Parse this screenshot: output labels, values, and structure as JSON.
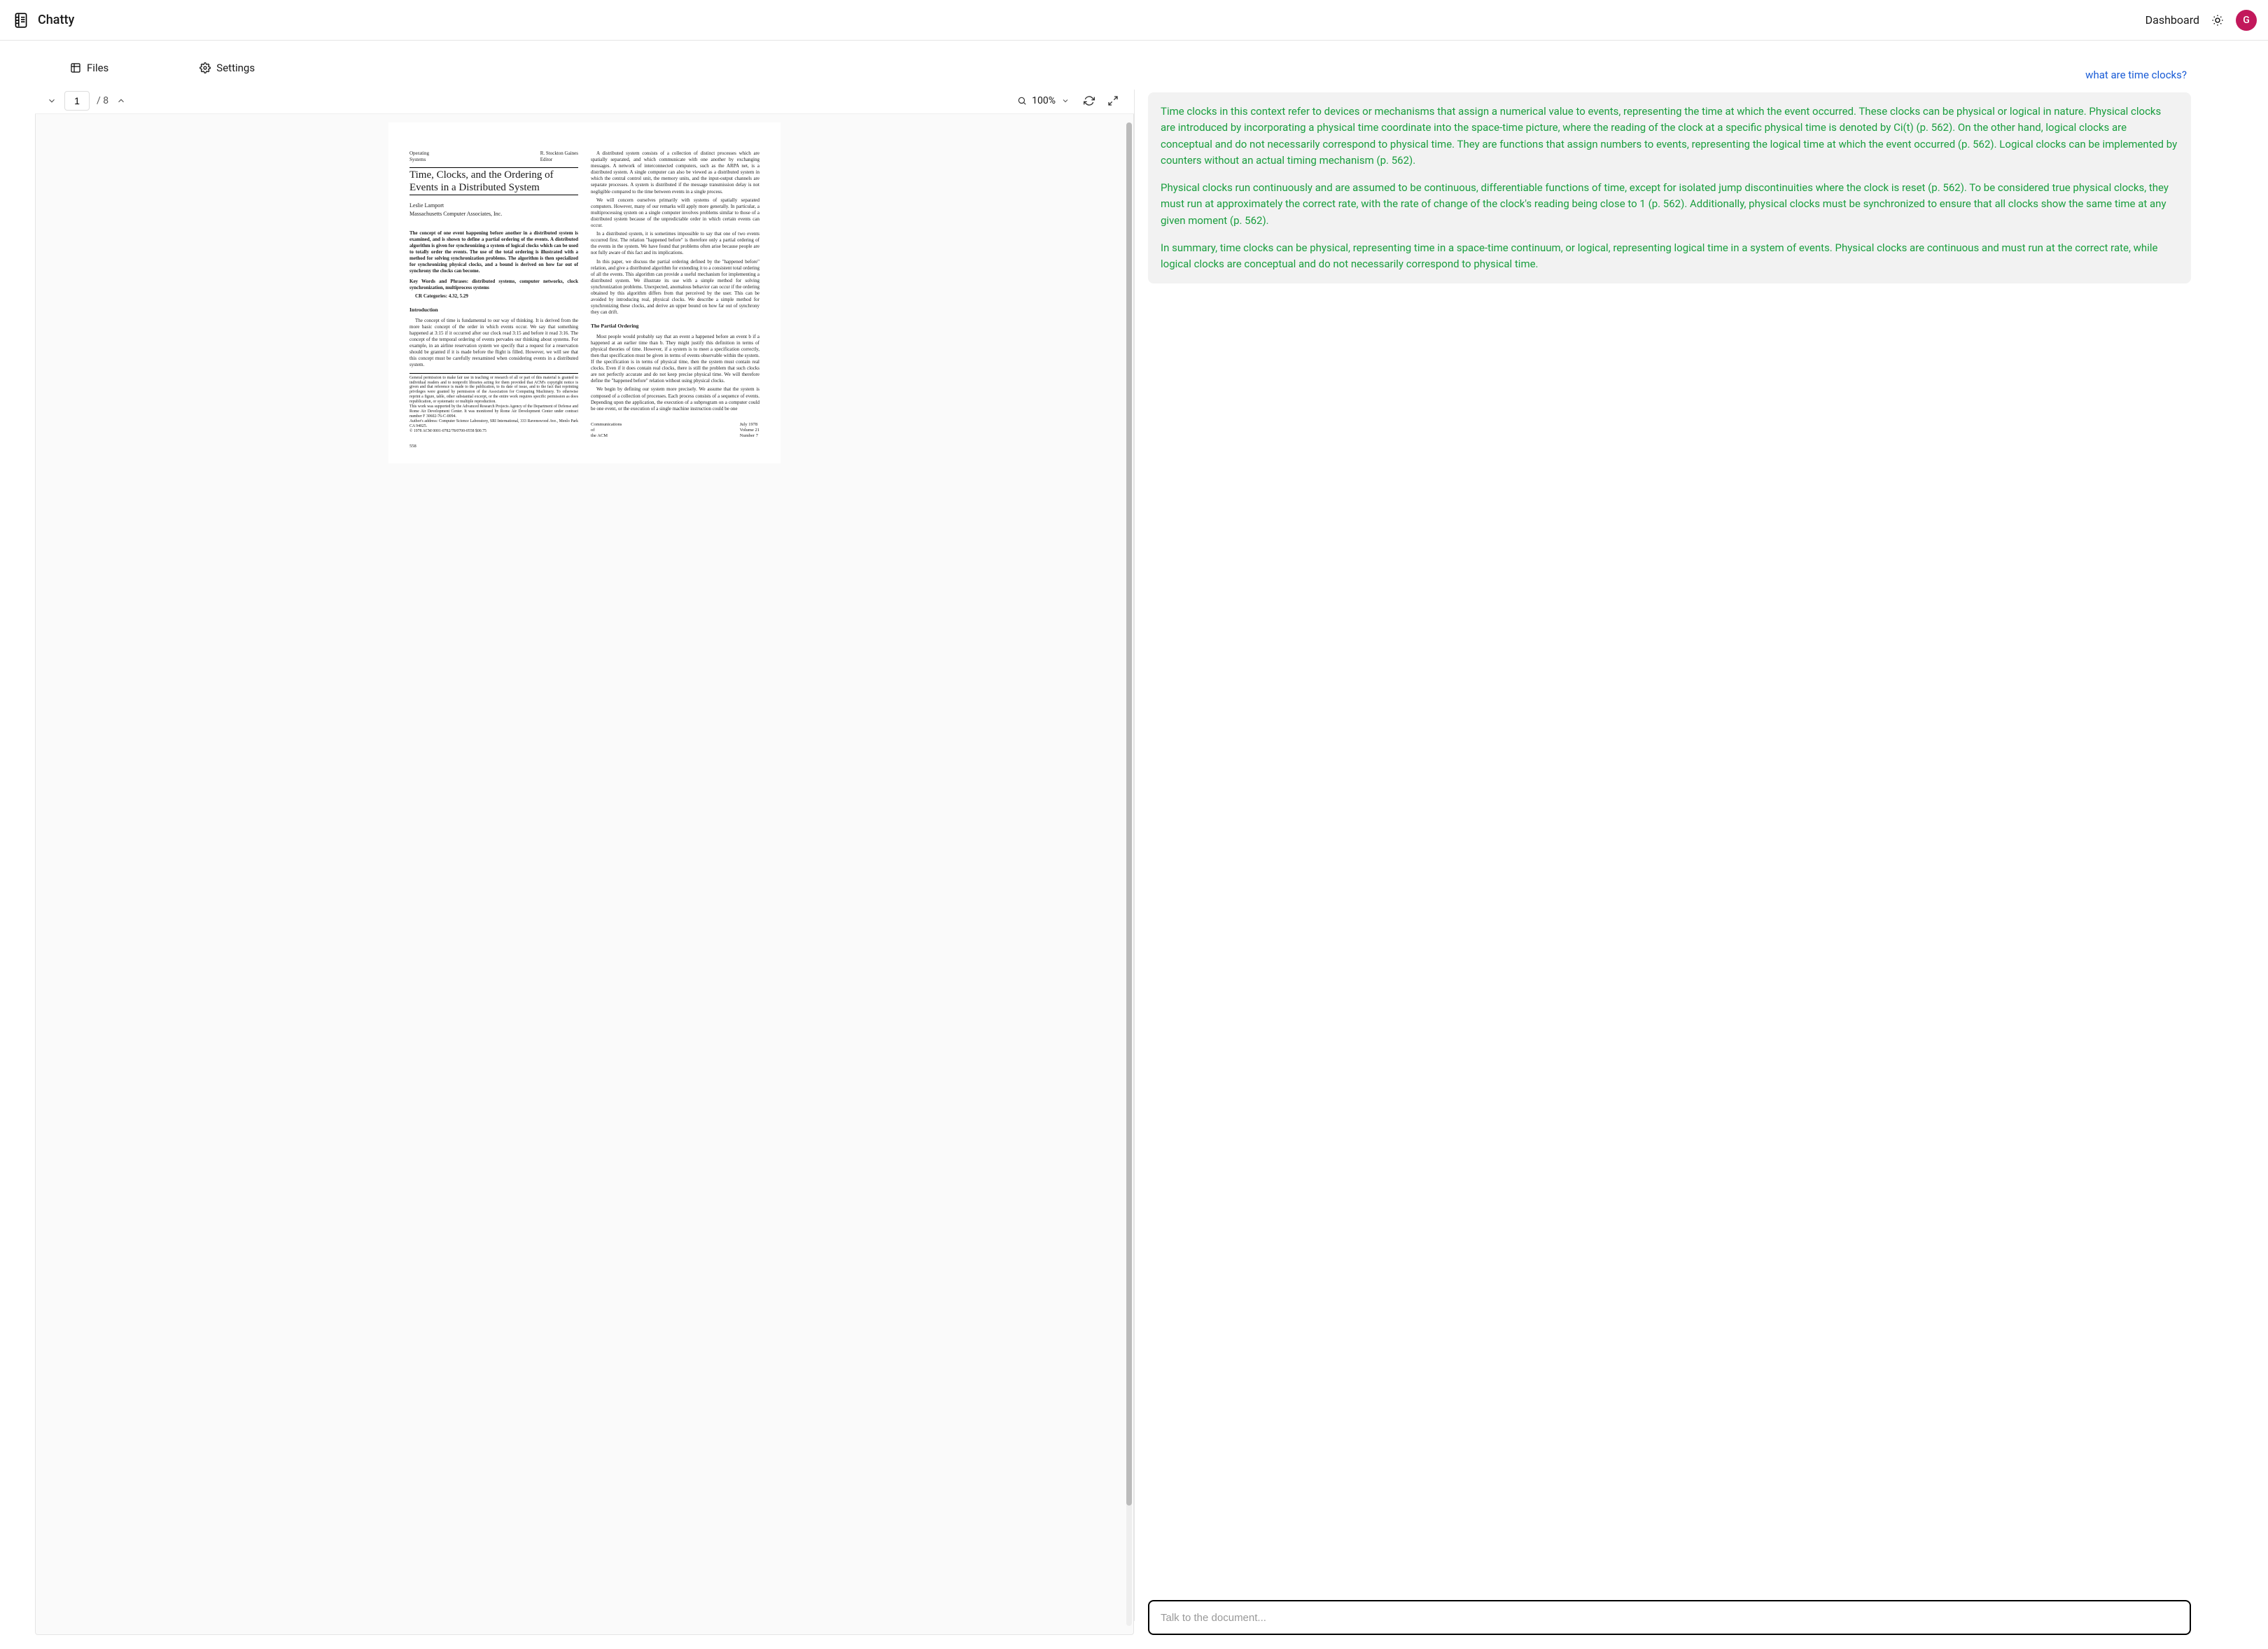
{
  "app": {
    "name": "Chatty"
  },
  "topbar": {
    "dashboard": "Dashboard",
    "avatar_initial": "G"
  },
  "sidebar": {
    "files_label": "Files",
    "settings_label": "Settings"
  },
  "pdf": {
    "current_page": "1",
    "total_pages": "/ 8",
    "zoom": "100%",
    "overhead_left": "Operating\nSystems",
    "overhead_right": "R. Stockton Gaines\nEditor",
    "title": "Time, Clocks, and the Ordering of Events in a Distributed System",
    "author": "Leslie Lamport",
    "affil": "Massachusetts Computer Associates, Inc.",
    "abstract": "The concept of one event happening before another in a distributed system is examined, and is shown to define a partial ordering of the events. A distributed algorithm is given for synchronizing a system of logical clocks which can be used to totally order the events. The use of the total ordering is illustrated with a method for solving synchronization problems. The algorithm is then specialized for synchronizing physical clocks, and a bound is derived on how far out of synchrony the clocks can become.",
    "keywords": "Key Words and Phrases: distributed systems, computer networks, clock synchronization, multiprocess systems",
    "cr": "CR Categories: 4.32, 5.29",
    "intro_heading": "Introduction",
    "intro_p1": "The concept of time is fundamental to our way of thinking. It is derived from the more basic concept of the order in which events occur. We say that something happened at 3:15 if it occurred after our clock read 3:15 and before it read 3:16. The concept of the temporal ordering of events pervades our thinking about systems. For example, in an airline reservation system we specify that a request for a reservation should be granted if it is made before the flight is filled. However, we will see that this concept must be carefully reexamined when considering events in a distributed system.",
    "fineprint": "General permission to make fair use in teaching or research of all or part of this material is granted to individual readers and to nonprofit libraries acting for them provided that ACM's copyright notice is given and that reference is made to the publication, to its date of issue, and to the fact that reprinting privileges were granted by permission of the Association for Computing Machinery. To otherwise reprint a figure, table, other substantial excerpt, or the entire work requires specific permission as does republication, or systematic or multiple reproduction.\nThis work was supported by the Advanced Research Projects Agency of the Department of Defense and Rome Air Development Center. It was monitored by Rome Air Development Center under contract number F 30602-76-C-0094.\nAuthor's address: Computer Science Laboratory, SRI International, 333 Ravenswood Ave., Menlo Park CA 94025.\n© 1978 ACM 0001-0782/78/0700-0558 $00.75",
    "col2_p1": "A distributed system consists of a collection of distinct processes which are spatially separated, and which communicate with one another by exchanging messages. A network of interconnected computers, such as the ARPA net, is a distributed system. A single computer can also be viewed as a distributed system in which the central control unit, the memory units, and the input-output channels are separate processes. A system is distributed if the message transmission delay is not negligible compared to the time between events in a single process.",
    "col2_p2": "We will concern ourselves primarily with systems of spatially separated computers. However, many of our remarks will apply more generally. In particular, a multiprocessing system on a single computer involves problems similar to those of a distributed system because of the unpredictable order in which certain events can occur.",
    "col2_p3": "In a distributed system, it is sometimes impossible to say that one of two events occurred first. The relation \"happened before\" is therefore only a partial ordering of the events in the system. We have found that problems often arise because people are not fully aware of this fact and its implications.",
    "col2_p4": "In this paper, we discuss the partial ordering defined by the \"happened before\" relation, and give a distributed algorithm for extending it to a consistent total ordering of all the events. This algorithm can provide a useful mechanism for implementing a distributed system. We illustrate its use with a simple method for solving synchronization problems. Unexpected, anomalous behavior can occur if the ordering obtained by this algorithm differs from that perceived by the user. This can be avoided by introducing real, physical clocks. We describe a simple method for synchronizing these clocks, and derive an upper bound on how far out of synchrony they can drift.",
    "partial_heading": "The Partial Ordering",
    "col2_p5": "Most people would probably say that an event a happened before an event b if a happened at an earlier time than b. They might justify this definition in terms of physical theories of time. However, if a system is to meet a specification correctly, then that specification must be given in terms of events observable within the system. If the specification is in terms of physical time, then the system must contain real clocks. Even if it does contain real clocks, there is still the problem that such clocks are not perfectly accurate and do not keep precise physical time. We will therefore define the \"happened before\" relation without using physical clocks.",
    "col2_p6": "We begin by defining our system more precisely. We assume that the system is composed of a collection of processes. Each process consists of a sequence of events. Depending upon the application, the execution of a subprogram on a computer could be one event, or the execution of a single machine instruction could be one",
    "footer_page": "558",
    "footer_center": "Communications\nof\nthe ACM",
    "footer_right": "July 1978\nVolume 21\nNumber 7"
  },
  "chat": {
    "user_question": "what are time clocks?",
    "ai_p1": "Time clocks in this context refer to devices or mechanisms that assign a numerical value to events, representing the time at which the event occurred. These clocks can be physical or logical in nature. Physical clocks are introduced by incorporating a physical time coordinate into the space-time picture, where the reading of the clock at a specific physical time is denoted by Ci(t) (p. 562). On the other hand, logical clocks are conceptual and do not necessarily correspond to physical time. They are functions that assign numbers to events, representing the logical time at which the event occurred (p. 562). Logical clocks can be implemented by counters without an actual timing mechanism (p. 562).",
    "ai_p2": "Physical clocks run continuously and are assumed to be continuous, differentiable functions of time, except for isolated jump discontinuities where the clock is reset (p. 562). To be considered true physical clocks, they must run at approximately the correct rate, with the rate of change of the clock's reading being close to 1 (p. 562). Additionally, physical clocks must be synchronized to ensure that all clocks show the same time at any given moment (p. 562).",
    "ai_p3": "In summary, time clocks can be physical, representing time in a space-time continuum, or logical, representing logical time in a system of events. Physical clocks are continuous and must run at the correct rate, while logical clocks are conceptual and do not necessarily correspond to physical time.",
    "input_placeholder": "Talk to the document..."
  }
}
